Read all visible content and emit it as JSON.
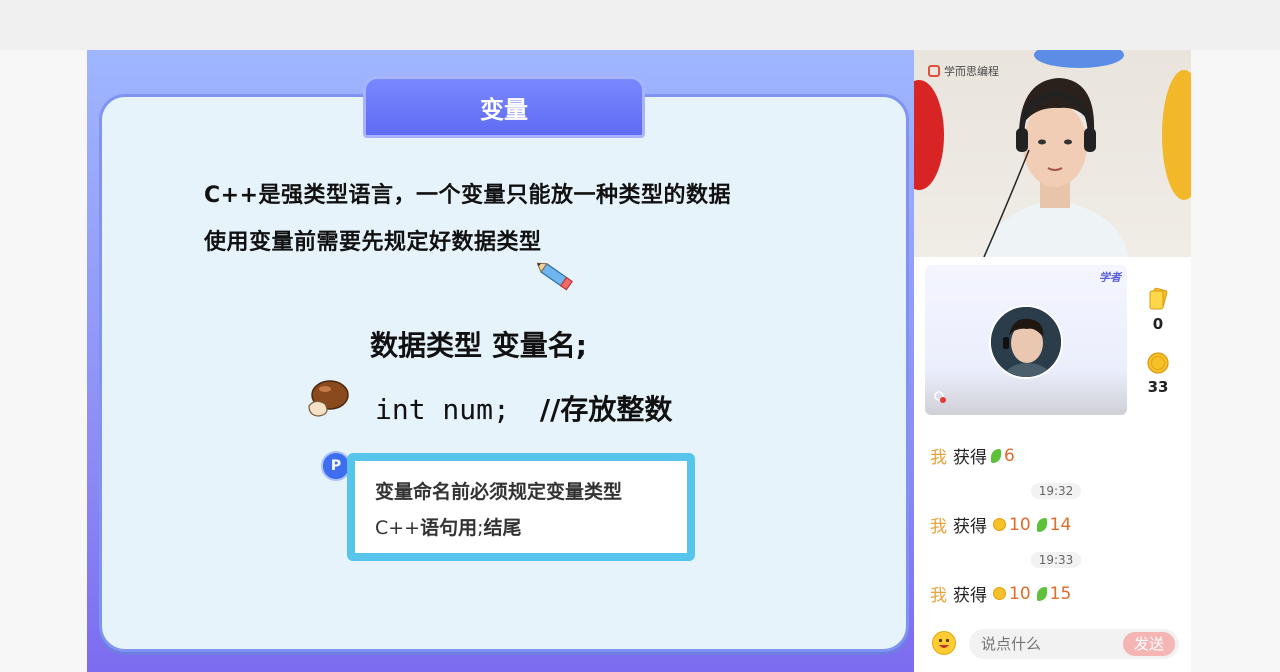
{
  "slide": {
    "title": "变量",
    "line1": "C++是强类型语言，一个变量只能放一种类型的数据",
    "line2": "使用变量前需要先规定好数据类型",
    "syntax": "数据类型  变量名;",
    "code_keyword": "int num;",
    "code_comment": "//存放整数",
    "note_badge": "P",
    "note_line1": "变量命名前必须规定变量类型",
    "note_line2_prefix": "C++",
    "note_line2_main": "语句用",
    "note_line2_semicolon": ";",
    "note_line2_suffix": "结尾"
  },
  "video": {
    "brand_text": "学而思编程"
  },
  "panel": {
    "mini_tag": "学者",
    "stats": [
      {
        "icon": "card-icon",
        "value": "0"
      },
      {
        "icon": "coin-icon",
        "value": "33"
      }
    ],
    "chat": [
      {
        "sender": "我",
        "verb": "获得",
        "coins": null,
        "leaves": "6"
      },
      {
        "time": "19:32"
      },
      {
        "sender": "我",
        "verb": "获得",
        "coins": "10",
        "leaves": "14"
      },
      {
        "time": "19:33"
      },
      {
        "sender": "我",
        "verb": "获得",
        "coins": "10",
        "leaves": "15"
      }
    ],
    "input_placeholder": "说点什么",
    "send_label": "发送"
  },
  "colors": {
    "slide_bg": "#8d8cf5",
    "card_bg": "#e7f3fb",
    "note_border": "#57c4ec",
    "me_color": "#e8a33a",
    "reward_color": "#e06b2a",
    "send_bg": "#f5b5b5"
  }
}
